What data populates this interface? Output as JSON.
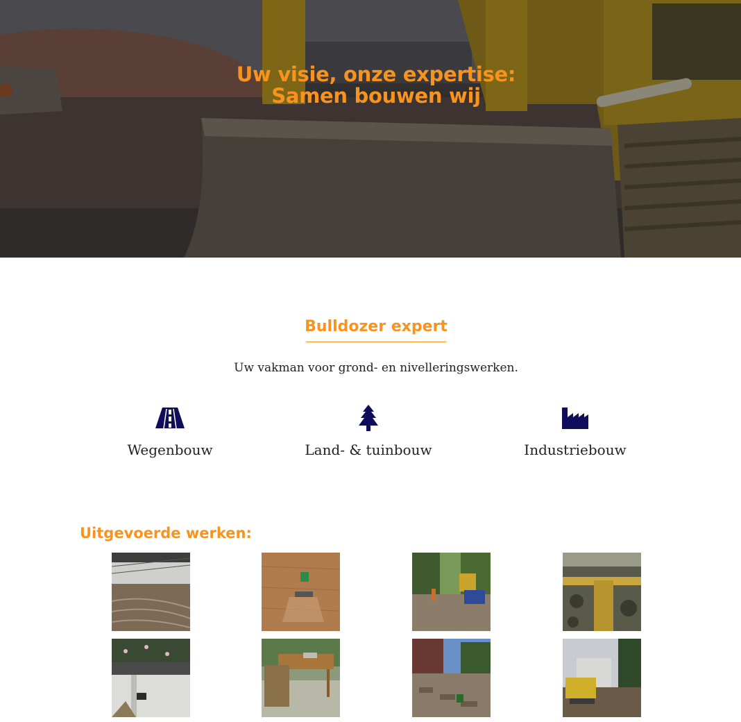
{
  "hero": {
    "title_line1": "Uw visie, onze expertise:",
    "title_line2": "Samen bouwen wij",
    "image": "bulldozer-photo"
  },
  "intro": {
    "heading": "Bulldozer expert",
    "tagline": "Uw vakman voor grond- en nivelleringswerken."
  },
  "services": [
    {
      "label": "Wegenbouw",
      "icon": "road-icon"
    },
    {
      "label": "Land- & tuinbouw",
      "icon": "pine-tree-icon"
    },
    {
      "label": "Industriebouw",
      "icon": "factory-icon"
    }
  ],
  "works": {
    "heading": "Uitgevoerde werken:",
    "items": [
      "warehouse-floor-photo",
      "tractor-field-photo",
      "street-loader-photo",
      "excavation-trench-photo",
      "garden-path-photo",
      "terrace-table-photo",
      "street-paving-photo",
      "machine-site-photo"
    ]
  },
  "colors": {
    "accent": "#f7931e",
    "icon": "#0e0e5a",
    "text": "#222222"
  }
}
